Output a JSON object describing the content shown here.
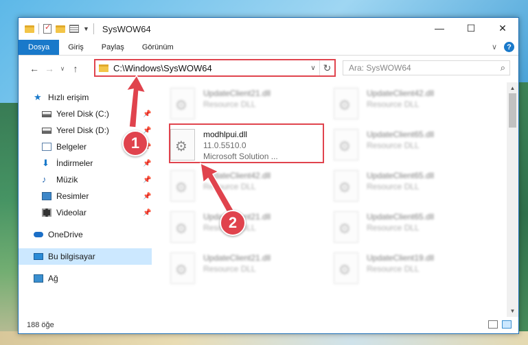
{
  "window": {
    "title": "SysWOW64",
    "minimize": "—",
    "maximize": "☐",
    "close": "✕"
  },
  "ribbon": {
    "tabs": [
      "Dosya",
      "Giriş",
      "Paylaş",
      "Görünüm"
    ]
  },
  "nav": {
    "back": "←",
    "forward": "→",
    "recent": "∨",
    "up": "↑",
    "address": "C:\\Windows\\SysWOW64",
    "search_placeholder": "Ara: SysWOW64"
  },
  "sidebar": {
    "items": [
      {
        "label": "Hızlı erişim"
      },
      {
        "label": "Yerel Disk (C:)"
      },
      {
        "label": "Yerel Disk (D:)"
      },
      {
        "label": "Belgeler"
      },
      {
        "label": "İndirmeler"
      },
      {
        "label": "Müzik"
      },
      {
        "label": "Resimler"
      },
      {
        "label": "Videolar"
      },
      {
        "label": "OneDrive"
      },
      {
        "label": "Bu bilgisayar"
      },
      {
        "label": "Ağ"
      }
    ]
  },
  "files": {
    "highlighted": {
      "name": "modhlpui.dll",
      "version": "11.0.5510.0",
      "desc": "Microsoft Solution ..."
    },
    "others": [
      {
        "name": "UpdateClient21.dll",
        "desc": "Resource DLL"
      },
      {
        "name": "UpdateClient42.dll",
        "desc": "Resource DLL"
      },
      {
        "name": "UpdateClient65.dll",
        "desc": "Resource DLL"
      },
      {
        "name": "UpdateClient42.dll",
        "desc": "Resource DLL"
      },
      {
        "name": "UpdateClient65.dll",
        "desc": "Resource DLL"
      },
      {
        "name": "UpdateClient21.dll",
        "desc": "Resource DLL"
      },
      {
        "name": "UpdateClient65.dll",
        "desc": "Resource DLL"
      },
      {
        "name": "UpdateClient21.dll",
        "desc": "Resource DLL"
      },
      {
        "name": "UpdateClient19.dll",
        "desc": "Resource DLL"
      }
    ]
  },
  "status": {
    "count": "188 öğe"
  },
  "annotations": {
    "step1": "1",
    "step2": "2",
    "color": "#e0434d"
  }
}
